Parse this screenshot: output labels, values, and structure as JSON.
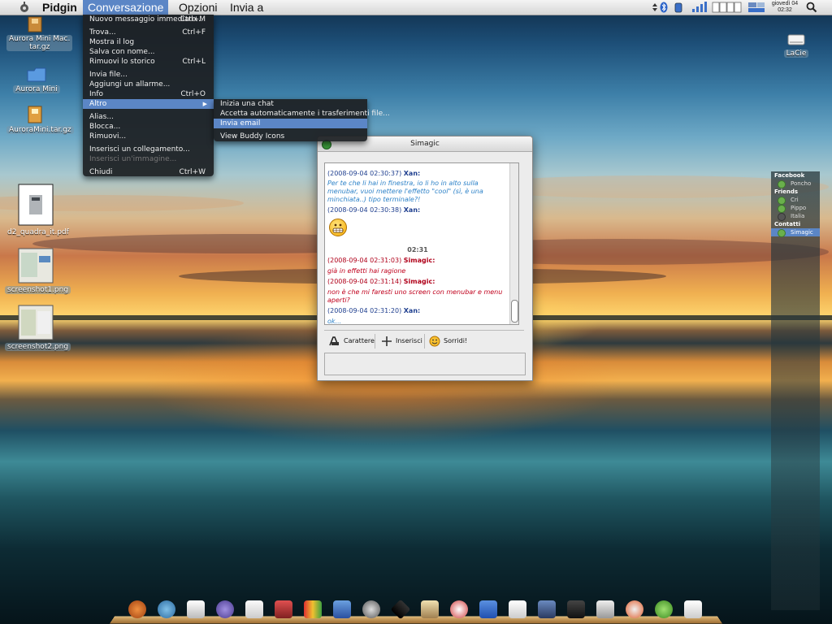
{
  "menubar": {
    "app": "Pidgin",
    "menus": [
      "Conversazione",
      "Opzioni",
      "Invia a"
    ],
    "clock": {
      "line1": "giovedì 04",
      "line2": "02:32"
    }
  },
  "conversation_menu": {
    "items": [
      {
        "label": "Nuovo messaggio immediato...",
        "shortcut": "Ctrl+M"
      },
      {
        "label": "Trova...",
        "shortcut": "Ctrl+F"
      },
      {
        "label": "Mostra il log",
        "shortcut": ""
      },
      {
        "label": "Salva con nome...",
        "shortcut": ""
      },
      {
        "label": "Rimuovi lo storico",
        "shortcut": "Ctrl+L"
      },
      {
        "label": "Invia file...",
        "shortcut": ""
      },
      {
        "label": "Aggiungi un allarme...",
        "shortcut": ""
      },
      {
        "label": "Info",
        "shortcut": "Ctrl+O"
      },
      {
        "label": "Altro",
        "shortcut": ""
      },
      {
        "label": "Alias...",
        "shortcut": ""
      },
      {
        "label": "Blocca...",
        "shortcut": ""
      },
      {
        "label": "Rimuovi...",
        "shortcut": ""
      },
      {
        "label": "Inserisci un collegamento...",
        "shortcut": ""
      },
      {
        "label": "Inserisci un'immagine...",
        "shortcut": ""
      },
      {
        "label": "Chiudi",
        "shortcut": "Ctrl+W"
      }
    ]
  },
  "submenu": {
    "items": [
      "Inizia una chat",
      "Accetta automaticamente i trasferimenti file...",
      "Invia email",
      "View Buddy Icons"
    ]
  },
  "desktop_icons": [
    {
      "label": "Aurora Mini Mac.\ntar.gz"
    },
    {
      "label": "Aurora Mini"
    },
    {
      "label": "AuroraMini.tar.gz"
    },
    {
      "label": "d2_quadra_it.pdf"
    },
    {
      "label": "screenshot1.png"
    },
    {
      "label": "screenshot2.png"
    },
    {
      "label": "LaCie"
    }
  ],
  "chat": {
    "title": "Simagic",
    "messages": [
      {
        "ts": "(2008-09-04 02:30:37)",
        "who": "Xan:",
        "text": "Per te che li hai in finestra, io li ho in alto sulla menubar, vuoi mettere l'effetto \"cool\" (sì, è una minchiata..) tipo terminale?!"
      },
      {
        "ts": "(2008-09-04 02:30:38)",
        "who": "Xan:",
        "text": ""
      },
      {
        "ts": "(2008-09-04 02:31:03)",
        "who": "Simagic:",
        "text": "già in effetti hai ragione"
      },
      {
        "ts": "(2008-09-04 02:31:14)",
        "who": "Simagic:",
        "text": "non è che mi faresti uno screen con menubar e menu aperti?"
      },
      {
        "ts": "(2008-09-04 02:31:20)",
        "who": "Xan:",
        "text": "ok..."
      }
    ],
    "time_separator": "02:31",
    "toolbar": {
      "font": "Carattere",
      "insert": "Inserisci",
      "smile": "Sorridi!"
    }
  },
  "buddy_list": {
    "groups": [
      {
        "name": "Facebook",
        "buddies": [
          {
            "name": "Poncho",
            "online": true
          }
        ]
      },
      {
        "name": "Friends",
        "buddies": [
          {
            "name": "Cri",
            "online": true
          },
          {
            "name": "Pippo",
            "online": true
          },
          {
            "name": "Italia",
            "online": false
          }
        ]
      },
      {
        "name": "Contatti",
        "buddies": [
          {
            "name": "Simagic",
            "online": true
          }
        ]
      }
    ]
  },
  "colors": {
    "accent": "#5b86c6",
    "xan": "#2d82c8",
    "simagic": "#c0001c"
  }
}
